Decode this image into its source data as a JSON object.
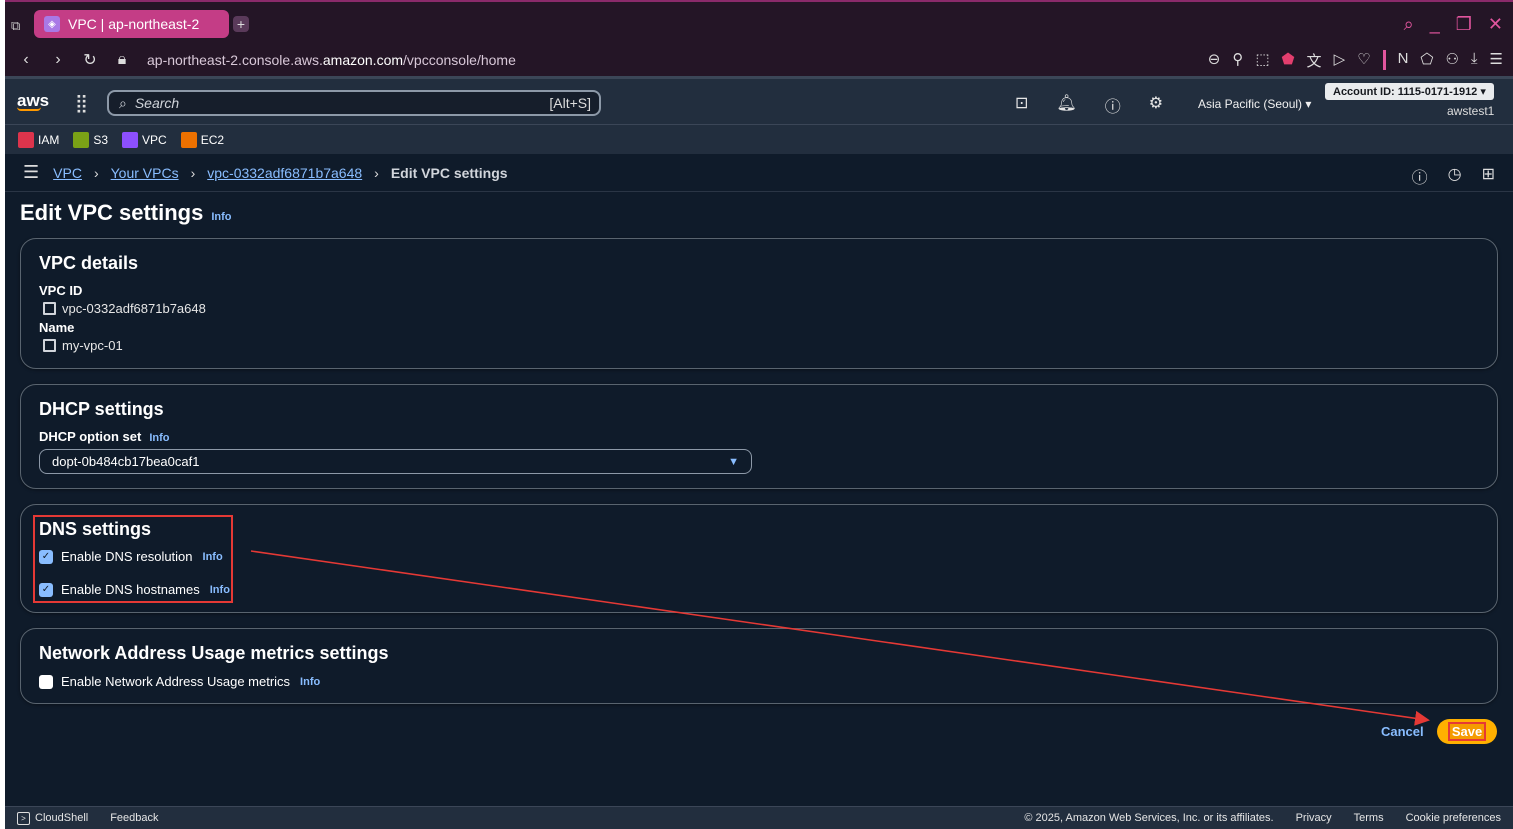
{
  "browser": {
    "tab_title": "VPC | ap-northeast-2",
    "new_tab_symbol": "+",
    "url_prefix": "ap-northeast-2.console.aws.",
    "url_domain": "amazon.com",
    "url_path": "/vpcconsole/home"
  },
  "aws_header": {
    "logo": "aws",
    "search_placeholder": "Search",
    "search_shortcut": "[Alt+S]",
    "region": "Asia Pacific (Seoul)",
    "account": "Account ID: 1115-0171-1912",
    "user": "awstest1"
  },
  "favorites": [
    {
      "label": "IAM",
      "color": "#dd344c"
    },
    {
      "label": "S3",
      "color": "#7aa116"
    },
    {
      "label": "VPC",
      "color": "#8c4fff"
    },
    {
      "label": "EC2",
      "color": "#ed7100"
    }
  ],
  "breadcrumb": {
    "items": [
      "VPC",
      "Your VPCs",
      "vpc-0332adf6871b7a648"
    ],
    "current": "Edit VPC settings"
  },
  "page": {
    "title": "Edit VPC settings",
    "info": "Info"
  },
  "vpc_details": {
    "heading": "VPC details",
    "id_label": "VPC ID",
    "id_value": "vpc-0332adf6871b7a648",
    "name_label": "Name",
    "name_value": "my-vpc-01"
  },
  "dhcp": {
    "heading": "DHCP settings",
    "option_label": "DHCP option set",
    "info": "Info",
    "selected": "dopt-0b484cb17bea0caf1"
  },
  "dns": {
    "heading": "DNS settings",
    "resolution_label": "Enable DNS resolution",
    "hostnames_label": "Enable DNS hostnames",
    "info": "Info",
    "resolution_checked": true,
    "hostnames_checked": true
  },
  "nau": {
    "heading": "Network Address Usage metrics settings",
    "label": "Enable Network Address Usage metrics",
    "info": "Info",
    "checked": false
  },
  "actions": {
    "cancel": "Cancel",
    "save": "Save"
  },
  "footer": {
    "cloudshell": "CloudShell",
    "feedback": "Feedback",
    "copyright": "© 2025, Amazon Web Services, Inc. or its affiliates.",
    "privacy": "Privacy",
    "terms": "Terms",
    "cookies": "Cookie preferences"
  }
}
